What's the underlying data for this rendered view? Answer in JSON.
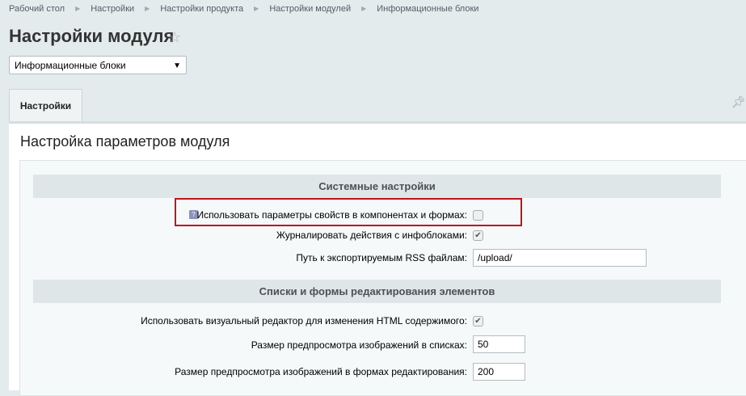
{
  "breadcrumb": [
    "Рабочий стол",
    "Настройки",
    "Настройки продукта",
    "Настройки модулей",
    "Информационные блоки"
  ],
  "title": "Настройки модуля",
  "module_select": {
    "value": "Информационные блоки"
  },
  "tabs": [
    {
      "label": "Настройки"
    }
  ],
  "subtitle": "Настройка параметров модуля",
  "sections": [
    {
      "title": "Системные настройки"
    },
    {
      "title": "Списки и формы редактирования элементов"
    }
  ],
  "fields": [
    {
      "label": "Использовать параметры свойств в компонентах и формах:",
      "checked": false
    },
    {
      "label": "Журналировать действия с инфоблоками:",
      "checked": true
    },
    {
      "label": "Путь к экспортируемым RSS файлам:",
      "value": "/upload/"
    },
    {
      "label": "Использовать визуальный редактор для изменения HTML содержимого:",
      "checked": true
    },
    {
      "label": "Размер предпросмотра изображений в списках:",
      "value": "50"
    },
    {
      "label": "Размер предпросмотра изображений в формах редактирования:",
      "value": "200"
    }
  ],
  "hint_icon": "?",
  "check_mark": "✔"
}
